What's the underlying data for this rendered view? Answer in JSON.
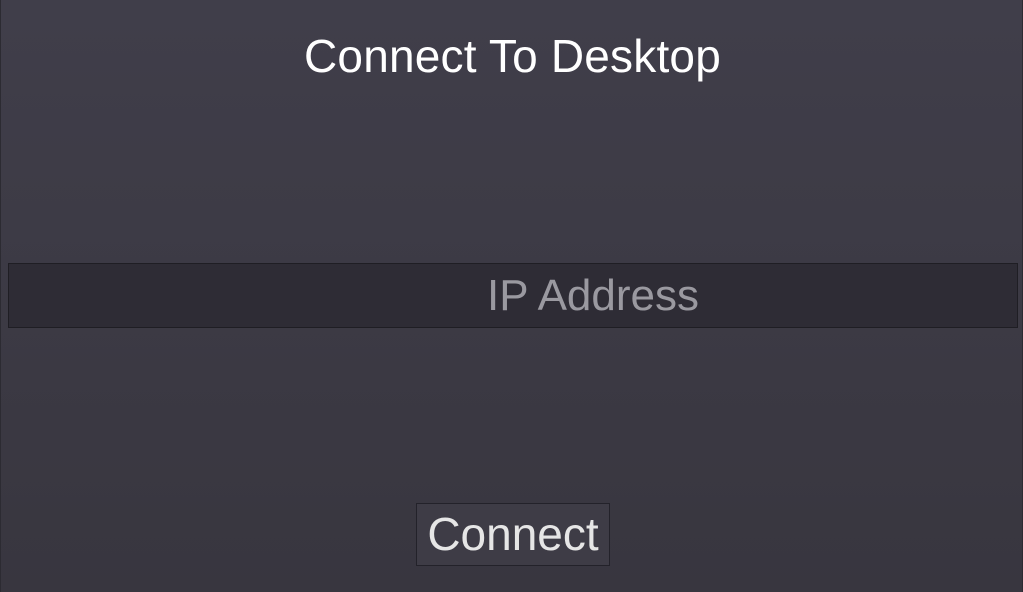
{
  "dialog": {
    "title": "Connect To Desktop",
    "ip_field": {
      "placeholder": "IP Address",
      "value": ""
    },
    "connect_label": "Connect"
  },
  "colors": {
    "background_top": "#403e4a",
    "background_bottom": "#38363f",
    "input_background": "#2e2c35",
    "button_background": "#3e3c46",
    "title_text": "#ffffff",
    "placeholder_text": "#9a99a0"
  }
}
